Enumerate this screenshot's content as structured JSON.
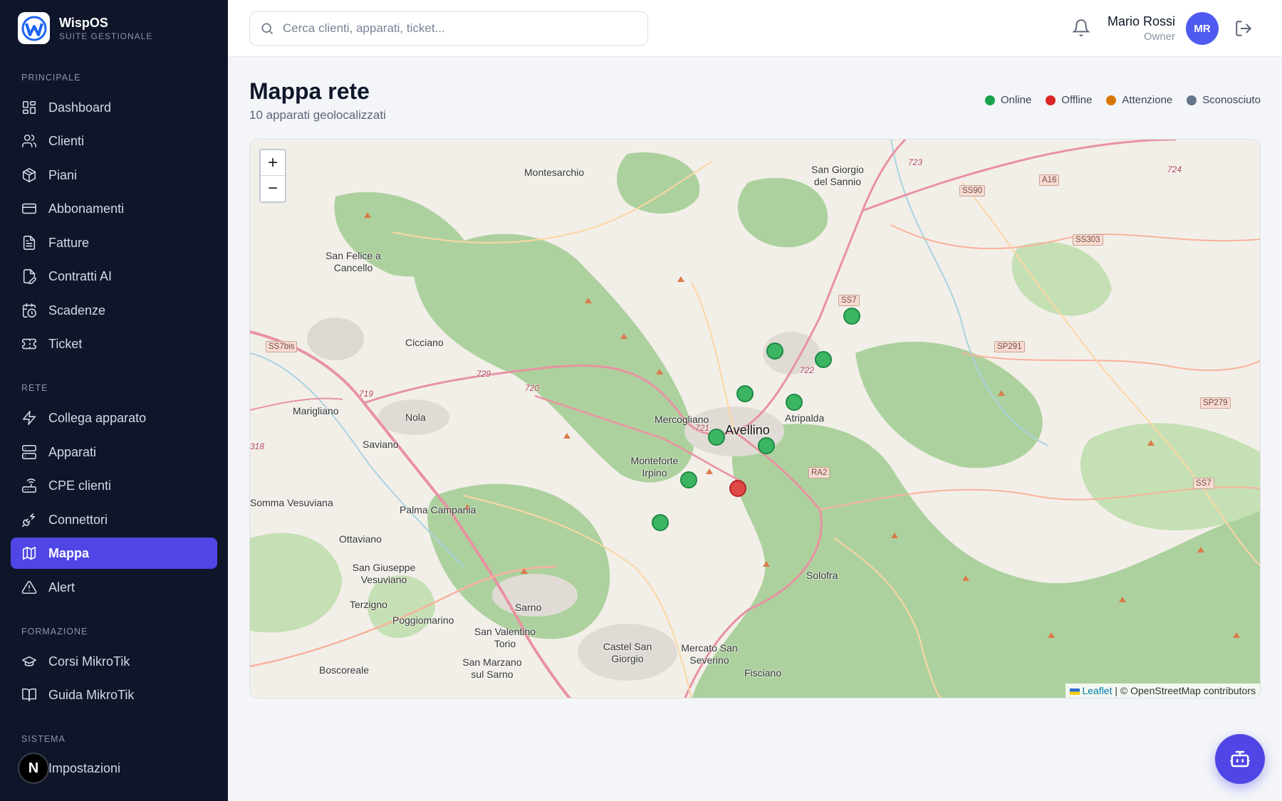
{
  "brand": {
    "name": "WispOS",
    "subtitle": "SUITE GESTIONALE"
  },
  "sidebar": {
    "sections": [
      {
        "label": "PRINCIPALE"
      },
      {
        "label": "RETE"
      },
      {
        "label": "FORMAZIONE"
      },
      {
        "label": "SISTEMA"
      }
    ],
    "items": [
      {
        "label": "Dashboard",
        "icon": "dashboard-icon"
      },
      {
        "label": "Clienti",
        "icon": "users-icon"
      },
      {
        "label": "Piani",
        "icon": "package-icon"
      },
      {
        "label": "Abbonamenti",
        "icon": "credit-card-icon"
      },
      {
        "label": "Fatture",
        "icon": "file-text-icon"
      },
      {
        "label": "Contratti AI",
        "icon": "file-pen-icon"
      },
      {
        "label": "Scadenze",
        "icon": "calendar-clock-icon"
      },
      {
        "label": "Ticket",
        "icon": "ticket-icon"
      },
      {
        "label": "Collega apparato",
        "icon": "zap-icon"
      },
      {
        "label": "Apparati",
        "icon": "server-icon"
      },
      {
        "label": "CPE clienti",
        "icon": "router-icon"
      },
      {
        "label": "Connettori",
        "icon": "plug-icon"
      },
      {
        "label": "Mappa",
        "icon": "map-icon",
        "active": true
      },
      {
        "label": "Alert",
        "icon": "alert-triangle-icon"
      },
      {
        "label": "Corsi MikroTik",
        "icon": "graduation-cap-icon"
      },
      {
        "label": "Guida MikroTik",
        "icon": "book-open-icon"
      },
      {
        "label": "Impostazioni",
        "icon": "settings-icon"
      }
    ],
    "dev_badge": "N"
  },
  "topbar": {
    "search_placeholder": "Cerca clienti, apparati, ticket...",
    "user_name": "Mario Rossi",
    "user_role": "Owner",
    "avatar_initials": "MR"
  },
  "page": {
    "title": "Mappa rete",
    "subtitle": "10 apparati geolocalizzati"
  },
  "legend": [
    {
      "label": "Online",
      "color": "#16a34a"
    },
    {
      "label": "Offline",
      "color": "#dc2626"
    },
    {
      "label": "Attenzione",
      "color": "#d97706"
    },
    {
      "label": "Sconosciuto",
      "color": "#64748b"
    }
  ],
  "map": {
    "zoom_in": "+",
    "zoom_out": "−",
    "attribution_link": "Leaflet",
    "attribution_text": " | © OpenStreetMap contributors",
    "places": [
      "Montesarchio",
      "San Giorgio del Sannio",
      "San Felice a Cancello",
      "Cicciano",
      "Marigliano",
      "Nola",
      "Saviano",
      "Mercogliano",
      "Avellino",
      "Atripalda",
      "Monteforte Irpino",
      "Somma Vesuviana",
      "Palma Campania",
      "Ottaviano",
      "San Giuseppe Vesuviano",
      "Terzigno",
      "Poggiomarino",
      "Sarno",
      "San Valentino Torio",
      "San Marzano sul Sarno",
      "Castel San Giorgio",
      "Mercato San Severino",
      "Fisciano",
      "Solofra",
      "Boscoreale"
    ],
    "roads": [
      "SS90",
      "A16",
      "SS303",
      "SS7",
      "SS7bis",
      "SP291",
      "SP279",
      "RA2",
      "SS7",
      "729",
      "720",
      "719",
      "721",
      "723",
      "724",
      "722",
      "318"
    ],
    "markers": [
      {
        "status": "online"
      },
      {
        "status": "online"
      },
      {
        "status": "online"
      },
      {
        "status": "online"
      },
      {
        "status": "online"
      },
      {
        "status": "online"
      },
      {
        "status": "online"
      },
      {
        "status": "online"
      },
      {
        "status": "offline"
      },
      {
        "status": "online"
      }
    ]
  }
}
